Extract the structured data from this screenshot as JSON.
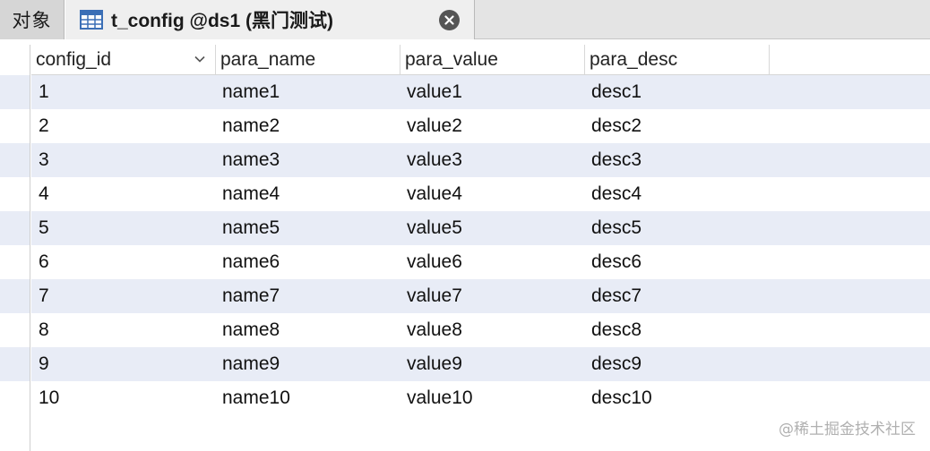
{
  "tabs": {
    "objects_label": "对象",
    "active_title": "t_config @ds1 (黑门测试)"
  },
  "table": {
    "columns": [
      "config_id",
      "para_name",
      "para_value",
      "para_desc"
    ],
    "rows": [
      [
        "1",
        "name1",
        "value1",
        "desc1"
      ],
      [
        "2",
        "name2",
        "value2",
        "desc2"
      ],
      [
        "3",
        "name3",
        "value3",
        "desc3"
      ],
      [
        "4",
        "name4",
        "value4",
        "desc4"
      ],
      [
        "5",
        "name5",
        "value5",
        "desc5"
      ],
      [
        "6",
        "name6",
        "value6",
        "desc6"
      ],
      [
        "7",
        "name7",
        "value7",
        "desc7"
      ],
      [
        "8",
        "name8",
        "value8",
        "desc8"
      ],
      [
        "9",
        "name9",
        "value9",
        "desc9"
      ],
      [
        "10",
        "name10",
        "value10",
        "desc10"
      ]
    ]
  },
  "watermark": "@稀土掘金技术社区",
  "colors": {
    "row_alt": "#e8ecf6",
    "tab_bar": "#e4e4e4",
    "active_tab": "#efefef",
    "icon_blue": "#3b6fb6"
  },
  "icons": {
    "table": "table-grid-icon",
    "close": "close-circle-icon",
    "sort": "chevron-down-icon"
  }
}
